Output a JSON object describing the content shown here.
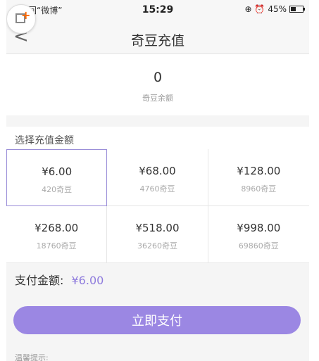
{
  "status_bar": {
    "back_app": "◀ 返回“微博”",
    "time": "15:29",
    "icons": "⊕ ⏰",
    "battery_text": "45%",
    "battery_level": 0.45
  },
  "nav": {
    "back_icon": "chevron-left-icon",
    "back_glyph": "<",
    "title": "奇豆充值"
  },
  "balance": {
    "value": "0",
    "label": "奇豆余额"
  },
  "section_label": "选择充值金额",
  "options": [
    {
      "price": "¥6.00",
      "beans": "420奇豆"
    },
    {
      "price": "¥68.00",
      "beans": "4760奇豆"
    },
    {
      "price": "¥128.00",
      "beans": "8960奇豆"
    },
    {
      "price": "¥268.00",
      "beans": "18760奇豆"
    },
    {
      "price": "¥518.00",
      "beans": "36260奇豆"
    },
    {
      "price": "¥998.00",
      "beans": "69860奇豆"
    }
  ],
  "payment": {
    "label": "支付金额:",
    "amount": "¥6.00",
    "button": "立即支付"
  },
  "tips_label": "温馨提示:",
  "colors": {
    "accent": "#9b87e3",
    "amount_text": "#8f7cdd",
    "corner_plus": "#ff6a00"
  }
}
